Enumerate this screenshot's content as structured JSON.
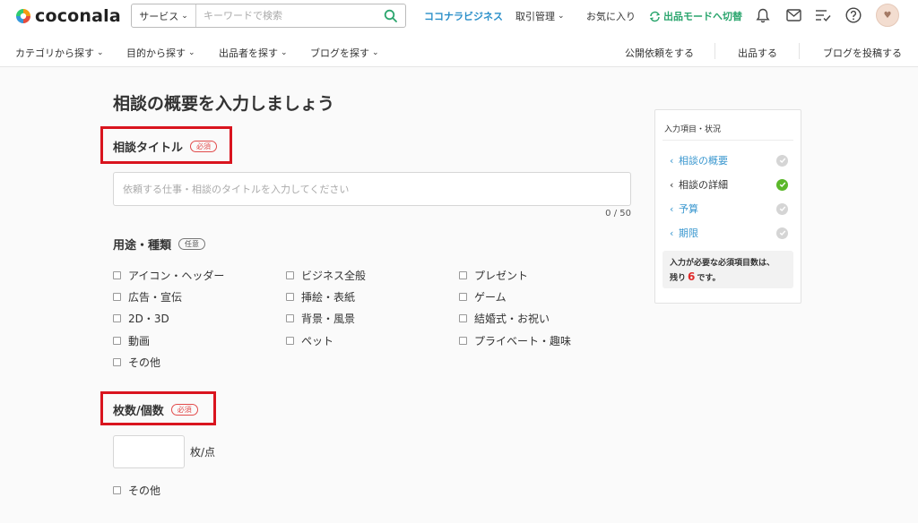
{
  "header": {
    "logo_text": "coconala",
    "search": {
      "category": "サービス",
      "placeholder": "キーワードで検索"
    },
    "links": {
      "business": "ココナラビジネス",
      "trading": "取引管理",
      "favorites": "お気に入り",
      "seller_mode": "出品モードへ切替"
    },
    "avatar_text": "♥"
  },
  "subnav": {
    "left": [
      "カテゴリから探す",
      "目的から探す",
      "出品者を探す",
      "ブログを探す"
    ],
    "right": [
      "公開依頼をする",
      "出品する",
      "ブログを投稿する"
    ]
  },
  "main": {
    "page_title": "相談の概要を入力しましょう",
    "title_section": {
      "label": "相談タイトル",
      "badge": "必須",
      "placeholder": "依頼する仕事・相談のタイトルを入力してください",
      "counter": "0 / 50"
    },
    "usage_section": {
      "label": "用途・種類",
      "badge": "任意",
      "options": [
        "アイコン・ヘッダー",
        "ビジネス全般",
        "プレゼント",
        "広告・宣伝",
        "挿絵・表紙",
        "ゲーム",
        "2D・3D",
        "背景・風景",
        "結婚式・お祝い",
        "動画",
        "ペット",
        "プライベート・趣味",
        "その他"
      ]
    },
    "quantity_section": {
      "label": "枚数/個数",
      "badge": "必須",
      "unit": "枚/点",
      "other_option": "その他"
    }
  },
  "progress_panel": {
    "heading": "入力項目・状況",
    "items": [
      {
        "label": "相談の概要",
        "state": "pending"
      },
      {
        "label": "相談の詳細",
        "state": "done"
      },
      {
        "label": "予算",
        "state": "pending"
      },
      {
        "label": "期限",
        "state": "pending"
      }
    ],
    "note_prefix": "入力が必要な必須項目数は、",
    "note_pre_count": "残り",
    "remaining_count": "6",
    "note_suffix": "です。"
  },
  "colors": {
    "link_blue": "#2a8fc9",
    "seller_green": "#2aa56d",
    "required_red": "#e24b4b",
    "highlight_box": "#d9141e",
    "done_green": "#5bb82a"
  }
}
